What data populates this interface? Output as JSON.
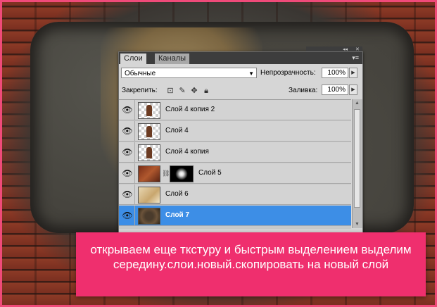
{
  "panel": {
    "tabs": [
      {
        "label": "Слои",
        "active": true
      },
      {
        "label": "Каналы",
        "active": false
      }
    ],
    "menu_icon": "panel-menu-icon",
    "blend_mode": "Обычные",
    "opacity_label": "Непрозрачность:",
    "opacity_value": "100%",
    "lock_label": "Закрепить:",
    "lock_icons": [
      "lock-transparent-icon",
      "lock-paint-icon",
      "lock-move-icon",
      "lock-all-icon"
    ],
    "fill_label": "Заливка:",
    "fill_value": "100%",
    "layers": [
      {
        "name": "Слой 4 копия 2",
        "visible": true,
        "selected": false
      },
      {
        "name": "Слой 4",
        "visible": true,
        "selected": false
      },
      {
        "name": "Слой 4 копия",
        "visible": true,
        "selected": false
      },
      {
        "name": "Слой 5",
        "visible": true,
        "selected": false,
        "has_mask": true
      },
      {
        "name": "Слой 6",
        "visible": true,
        "selected": false
      },
      {
        "name": "Слой 7",
        "visible": true,
        "selected": true
      }
    ]
  },
  "caption": {
    "text": "открываем еще ткстуру и быстрым выделением выделим середину.слои.новый.скопировать на новый слой"
  },
  "colors": {
    "frame": "#ef4a79",
    "caption_bg": "#ef2f6e",
    "selection": "#3d8ee6"
  }
}
